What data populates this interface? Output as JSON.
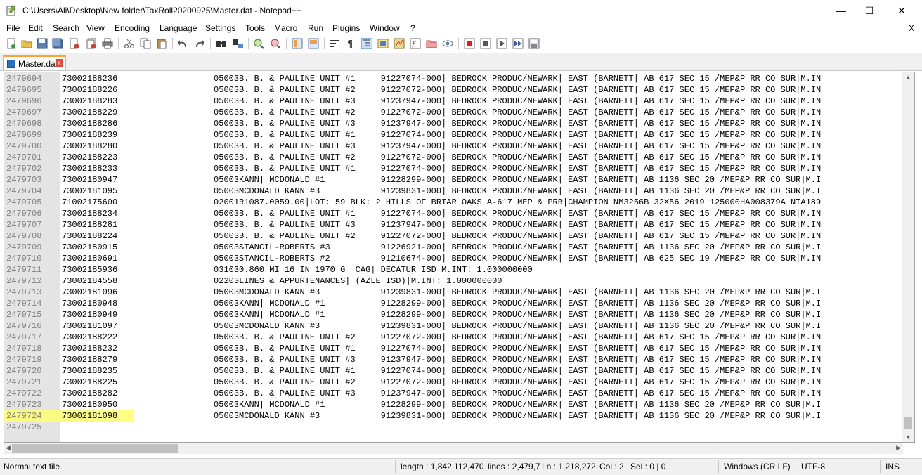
{
  "window": {
    "title": "C:\\Users\\Ali\\Desktop\\New folder\\TaxRoll20200925\\Master.dat - Notepad++",
    "minimize": "—",
    "maximize": "☐",
    "close": "✕"
  },
  "menu": {
    "items": [
      "File",
      "Edit",
      "Search",
      "View",
      "Encoding",
      "Language",
      "Settings",
      "Tools",
      "Macro",
      "Run",
      "Plugins",
      "Window",
      "?"
    ],
    "close_doc": "X"
  },
  "tab": {
    "label": "Master.dat",
    "close": "x"
  },
  "editor": {
    "lines": [
      {
        "n": "2479694",
        "t": "73002188236                   05003B. B. & PAULINE UNIT #1     91227074-000| BEDROCK PRODUC/NEWARK| EAST (BARNETT| AB 617 SEC 15 /MEP&P RR CO SUR|M.IN"
      },
      {
        "n": "2479695",
        "t": "73002188226                   05003B. B. & PAULINE UNIT #2     91227072-000| BEDROCK PRODUC/NEWARK| EAST (BARNETT| AB 617 SEC 15 /MEP&P RR CO SUR|M.IN"
      },
      {
        "n": "2479696",
        "t": "73002188283                   05003B. B. & PAULINE UNIT #3     91237947-000| BEDROCK PRODUC/NEWARK| EAST (BARNETT| AB 617 SEC 15 /MEP&P RR CO SUR|M.IN"
      },
      {
        "n": "2479697",
        "t": "73002188229                   05003B. B. & PAULINE UNIT #2     91227072-000| BEDROCK PRODUC/NEWARK| EAST (BARNETT| AB 617 SEC 15 /MEP&P RR CO SUR|M.IN"
      },
      {
        "n": "2479698",
        "t": "73002188286                   05003B. B. & PAULINE UNIT #3     91237947-000| BEDROCK PRODUC/NEWARK| EAST (BARNETT| AB 617 SEC 15 /MEP&P RR CO SUR|M.IN"
      },
      {
        "n": "2479699",
        "t": "73002188239                   05003B. B. & PAULINE UNIT #1     91227074-000| BEDROCK PRODUC/NEWARK| EAST (BARNETT| AB 617 SEC 15 /MEP&P RR CO SUR|M.IN"
      },
      {
        "n": "2479700",
        "t": "73002188280                   05003B. B. & PAULINE UNIT #3     91237947-000| BEDROCK PRODUC/NEWARK| EAST (BARNETT| AB 617 SEC 15 /MEP&P RR CO SUR|M.IN"
      },
      {
        "n": "2479701",
        "t": "73002188223                   05003B. B. & PAULINE UNIT #2     91227072-000| BEDROCK PRODUC/NEWARK| EAST (BARNETT| AB 617 SEC 15 /MEP&P RR CO SUR|M.IN"
      },
      {
        "n": "2479702",
        "t": "73002188233                   05003B. B. & PAULINE UNIT #1     91227074-000| BEDROCK PRODUC/NEWARK| EAST (BARNETT| AB 617 SEC 15 /MEP&P RR CO SUR|M.IN"
      },
      {
        "n": "2479703",
        "t": "73002180947                   05003KANN| MCDONALD #1           91228299-000| BEDROCK PRODUC/NEWARK| EAST (BARNETT| AB 1136 SEC 20 /MEP&P RR CO SUR|M.I"
      },
      {
        "n": "2479704",
        "t": "73002181095                   05003MCDONALD KANN #3            91239831-000| BEDROCK PRODUC/NEWARK| EAST (BARNETT| AB 1136 SEC 20 /MEP&P RR CO SUR|M.I"
      },
      {
        "n": "2479705",
        "t": "71002175600                   02001R1087.0059.00|LOT: 59 BLK: 2 HILLS OF BRIAR OAKS A-617 MEP & PRR|CHAMPION NM3256B 32X56 2019 125000HA008379A NTA189"
      },
      {
        "n": "2479706",
        "t": "73002188234                   05003B. B. & PAULINE UNIT #1     91227074-000| BEDROCK PRODUC/NEWARK| EAST (BARNETT| AB 617 SEC 15 /MEP&P RR CO SUR|M.IN"
      },
      {
        "n": "2479707",
        "t": "73002188281                   05003B. B. & PAULINE UNIT #3     91237947-000| BEDROCK PRODUC/NEWARK| EAST (BARNETT| AB 617 SEC 15 /MEP&P RR CO SUR|M.IN"
      },
      {
        "n": "2479708",
        "t": "73002188224                   05003B. B. & PAULINE UNIT #2     91227072-000| BEDROCK PRODUC/NEWARK| EAST (BARNETT| AB 617 SEC 15 /MEP&P RR CO SUR|M.IN"
      },
      {
        "n": "2479709",
        "t": "73002180915                   05003STANCIL-ROBERTS #3          91226921-000| BEDROCK PRODUC/NEWARK| EAST (BARNETT| AB 1136 SEC 20 /MEP&P RR CO SUR|M.I"
      },
      {
        "n": "2479710",
        "t": "73002180691                   05003STANCIL-ROBERTS #2          91210674-000| BEDROCK PRODUC/NEWARK| EAST (BARNETT| AB 625 SEC 19 /MEP&P RR CO SUR|M.IN"
      },
      {
        "n": "2479711",
        "t": "73002185936                   031030.860 MI 16 IN 1970 G  CAG| DECATUR ISD|M.INT: 1.000000000"
      },
      {
        "n": "2479712",
        "t": "73002184558                   02203LINES & APPURTENANCES| (AZLE ISD)|M.INT: 1.000000000"
      },
      {
        "n": "2479713",
        "t": "73002181096                   05003MCDONALD KANN #3            91239831-000| BEDROCK PRODUC/NEWARK| EAST (BARNETT| AB 1136 SEC 20 /MEP&P RR CO SUR|M.I"
      },
      {
        "n": "2479714",
        "t": "73002180948                   05003KANN| MCDONALD #1           91228299-000| BEDROCK PRODUC/NEWARK| EAST (BARNETT| AB 1136 SEC 20 /MEP&P RR CO SUR|M.I"
      },
      {
        "n": "2479715",
        "t": "73002180949                   05003KANN| MCDONALD #1           91228299-000| BEDROCK PRODUC/NEWARK| EAST (BARNETT| AB 1136 SEC 20 /MEP&P RR CO SUR|M.I"
      },
      {
        "n": "2479716",
        "t": "73002181097                   05003MCDONALD KANN #3            91239831-000| BEDROCK PRODUC/NEWARK| EAST (BARNETT| AB 1136 SEC 20 /MEP&P RR CO SUR|M.I"
      },
      {
        "n": "2479717",
        "t": "73002188222                   05003B. B. & PAULINE UNIT #2     91227072-000| BEDROCK PRODUC/NEWARK| EAST (BARNETT| AB 617 SEC 15 /MEP&P RR CO SUR|M.IN"
      },
      {
        "n": "2479718",
        "t": "73002188232                   05003B. B. & PAULINE UNIT #1     91227074-000| BEDROCK PRODUC/NEWARK| EAST (BARNETT| AB 617 SEC 15 /MEP&P RR CO SUR|M.IN"
      },
      {
        "n": "2479719",
        "t": "73002188279                   05003B. B. & PAULINE UNIT #3     91237947-000| BEDROCK PRODUC/NEWARK| EAST (BARNETT| AB 617 SEC 15 /MEP&P RR CO SUR|M.IN"
      },
      {
        "n": "2479720",
        "t": "73002188235                   05003B. B. & PAULINE UNIT #1     91227074-000| BEDROCK PRODUC/NEWARK| EAST (BARNETT| AB 617 SEC 15 /MEP&P RR CO SUR|M.IN"
      },
      {
        "n": "2479721",
        "t": "73002188225                   05003B. B. & PAULINE UNIT #2     91227072-000| BEDROCK PRODUC/NEWARK| EAST (BARNETT| AB 617 SEC 15 /MEP&P RR CO SUR|M.IN"
      },
      {
        "n": "2479722",
        "t": "73002188282                   05003B. B. & PAULINE UNIT #3     91237947-000| BEDROCK PRODUC/NEWARK| EAST (BARNETT| AB 617 SEC 15 /MEP&P RR CO SUR|M.IN"
      },
      {
        "n": "2479723",
        "t": "73002180950                   05003KANN| MCDONALD #1           91228299-000| BEDROCK PRODUC/NEWARK| EAST (BARNETT| AB 1136 SEC 20 /MEP&P RR CO SUR|M.I"
      },
      {
        "n": "2479724",
        "t": "73002181098                   05003MCDONALD KANN #3            91239831-000| BEDROCK PRODUC/NEWARK| EAST (BARNETT| AB 1136 SEC 20 /MEP&P RR CO SUR|M.I",
        "highlight": true
      },
      {
        "n": "2479725",
        "t": ""
      }
    ]
  },
  "status": {
    "type": "Normal text file",
    "length": "length : 1,842,112,470",
    "lines": "lines : 2,479,7",
    "ln": "Ln : 1,218,272",
    "col": "Col : 2",
    "sel": "Sel : 0 | 0",
    "eol": "Windows (CR LF)",
    "encoding": "UTF-8",
    "mode": "INS"
  },
  "colors": {
    "highlight": "#ffff70",
    "tab_accent": "#f8a33b",
    "gutter": "#e4e4e4"
  }
}
